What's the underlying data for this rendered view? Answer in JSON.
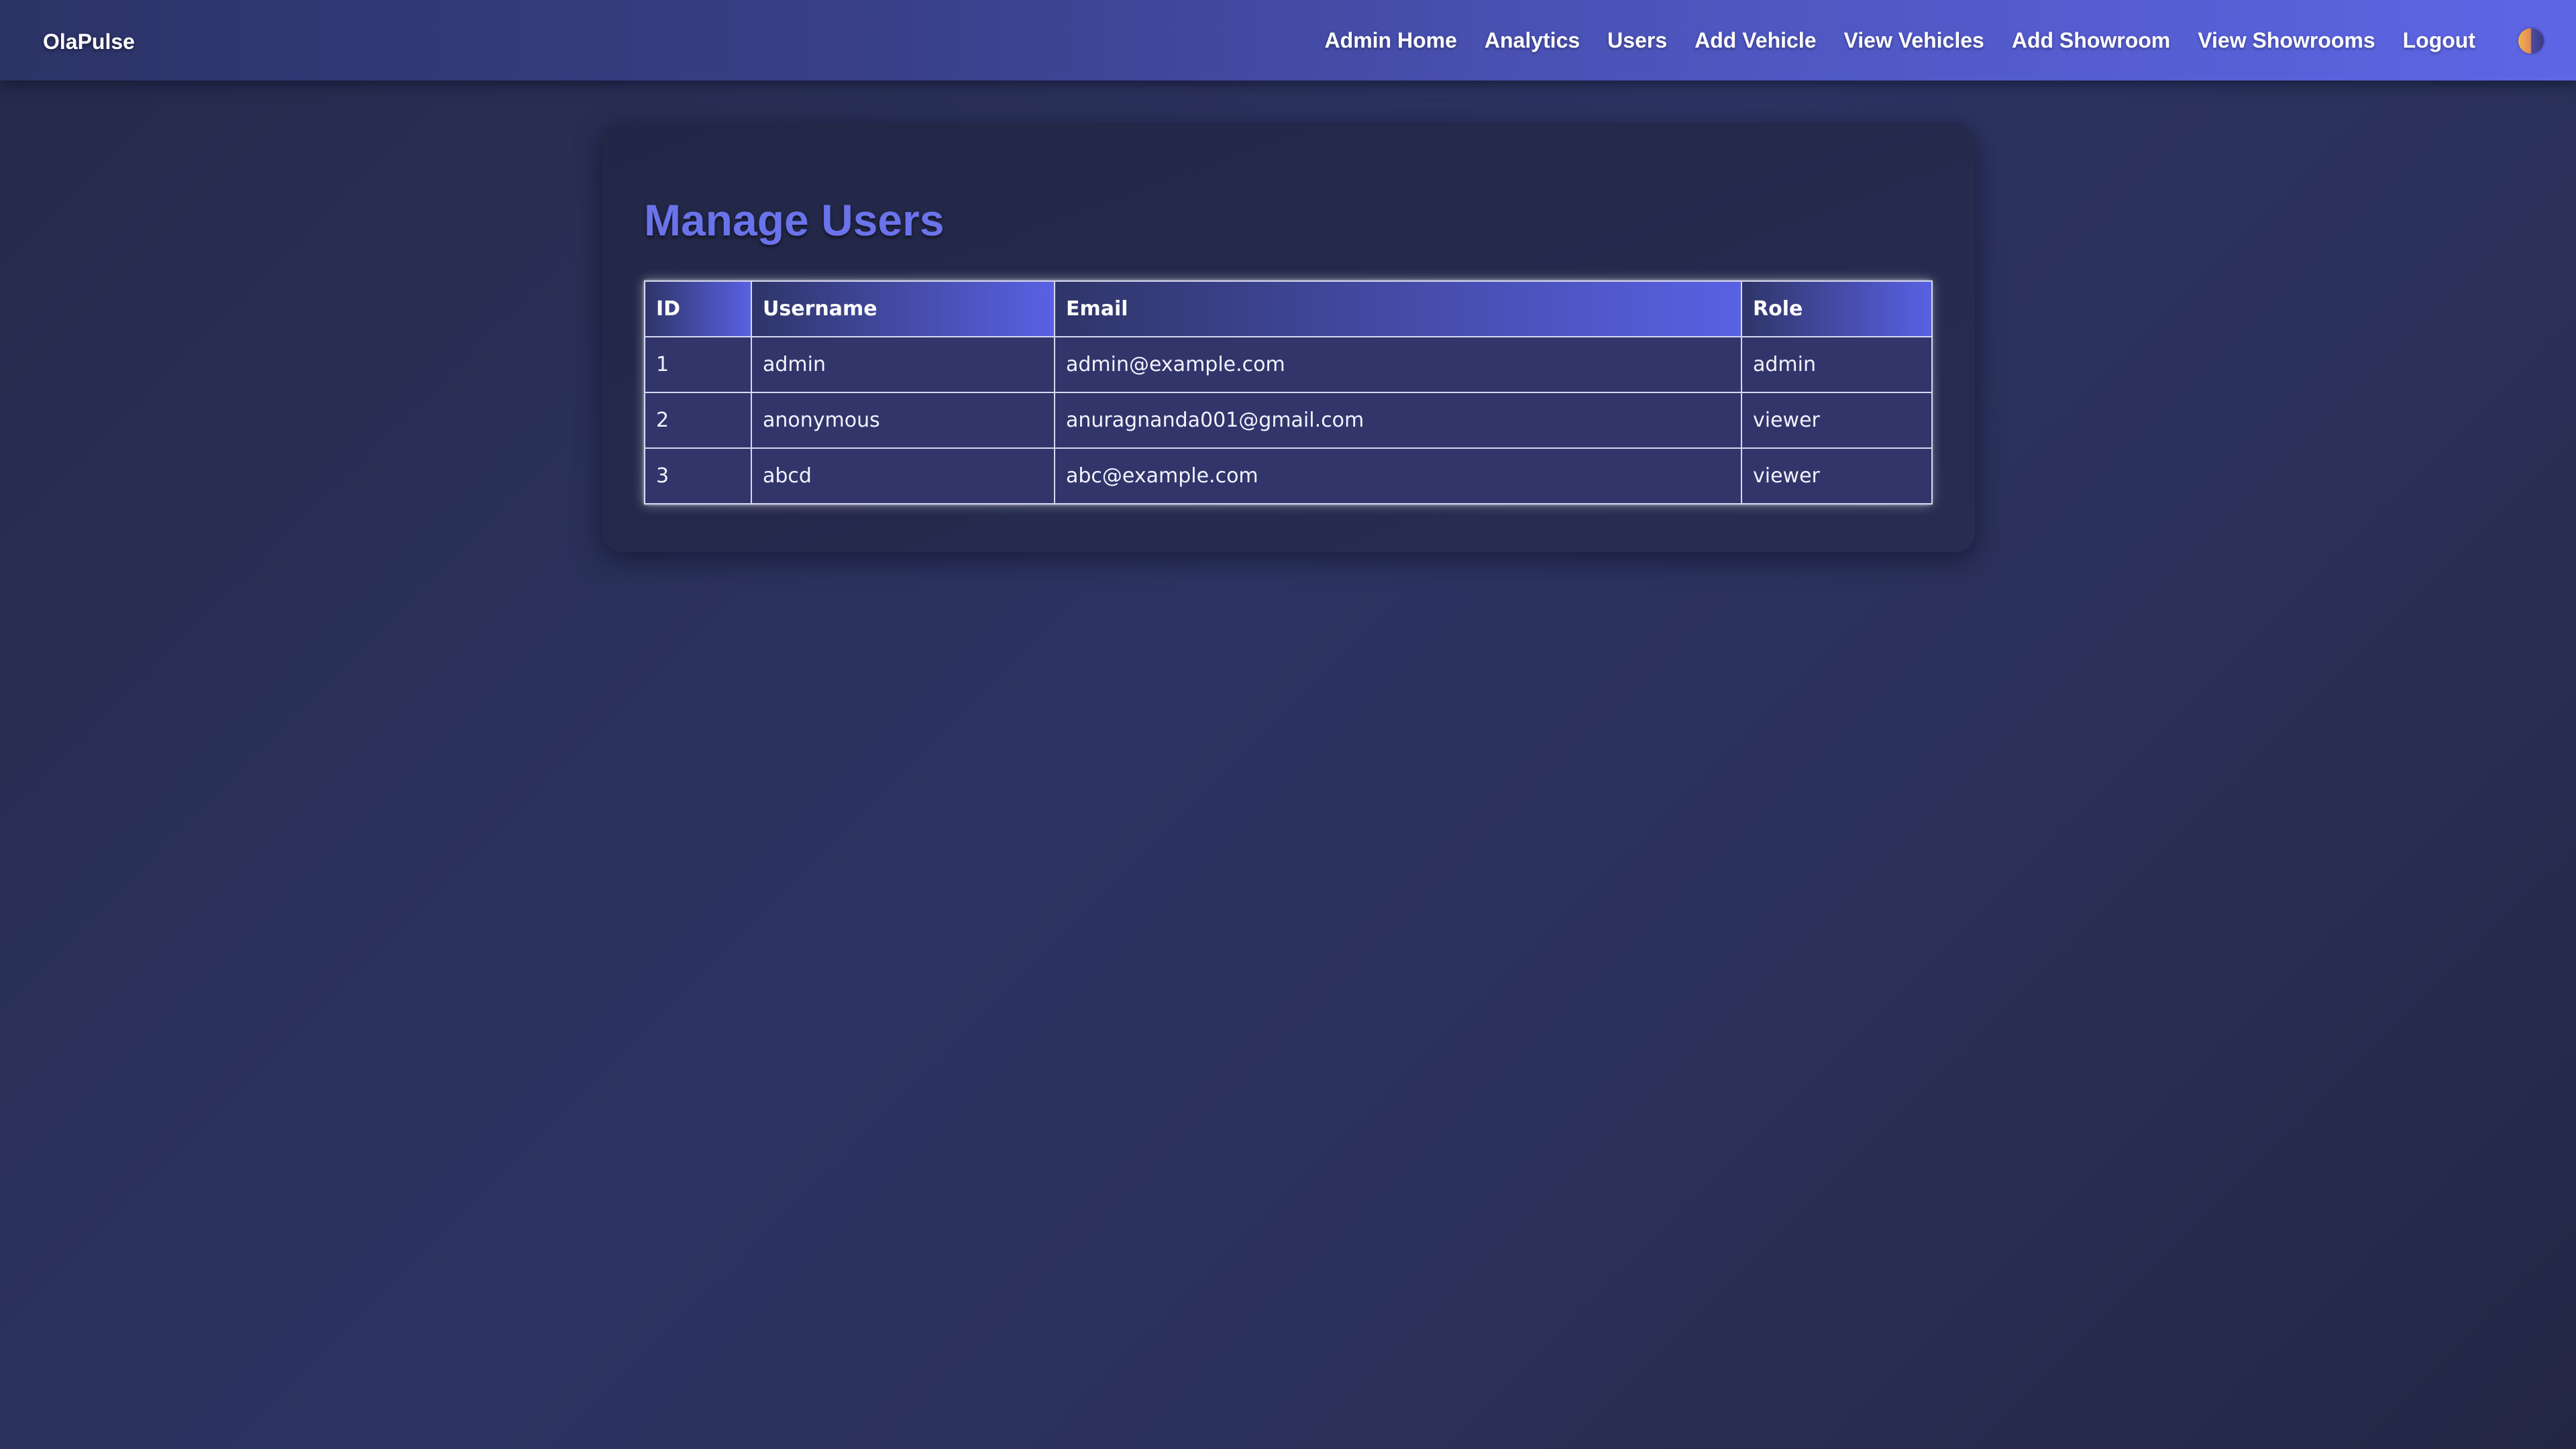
{
  "brand": {
    "name": "OlaPulse"
  },
  "nav": {
    "links": [
      {
        "label": "Admin Home"
      },
      {
        "label": "Analytics"
      },
      {
        "label": "Users"
      },
      {
        "label": "Add Vehicle"
      },
      {
        "label": "View Vehicles"
      },
      {
        "label": "Add Showroom"
      },
      {
        "label": "View Showrooms"
      },
      {
        "label": "Logout"
      }
    ],
    "theme_toggle_icon": "half-sun-moon-icon"
  },
  "main": {
    "title": "Manage Users",
    "table": {
      "columns": [
        "ID",
        "Username",
        "Email",
        "Role"
      ],
      "rows": [
        [
          "1",
          "admin",
          "admin@example.com",
          "admin"
        ],
        [
          "2",
          "anonymous",
          "anuragnanda001@gmail.com",
          "viewer"
        ],
        [
          "3",
          "abcd",
          "abc@example.com",
          "viewer"
        ]
      ]
    }
  },
  "colors": {
    "accent": "#6b73ea",
    "nav_gradient_end": "#5e66e6",
    "background": "#2d3462"
  }
}
